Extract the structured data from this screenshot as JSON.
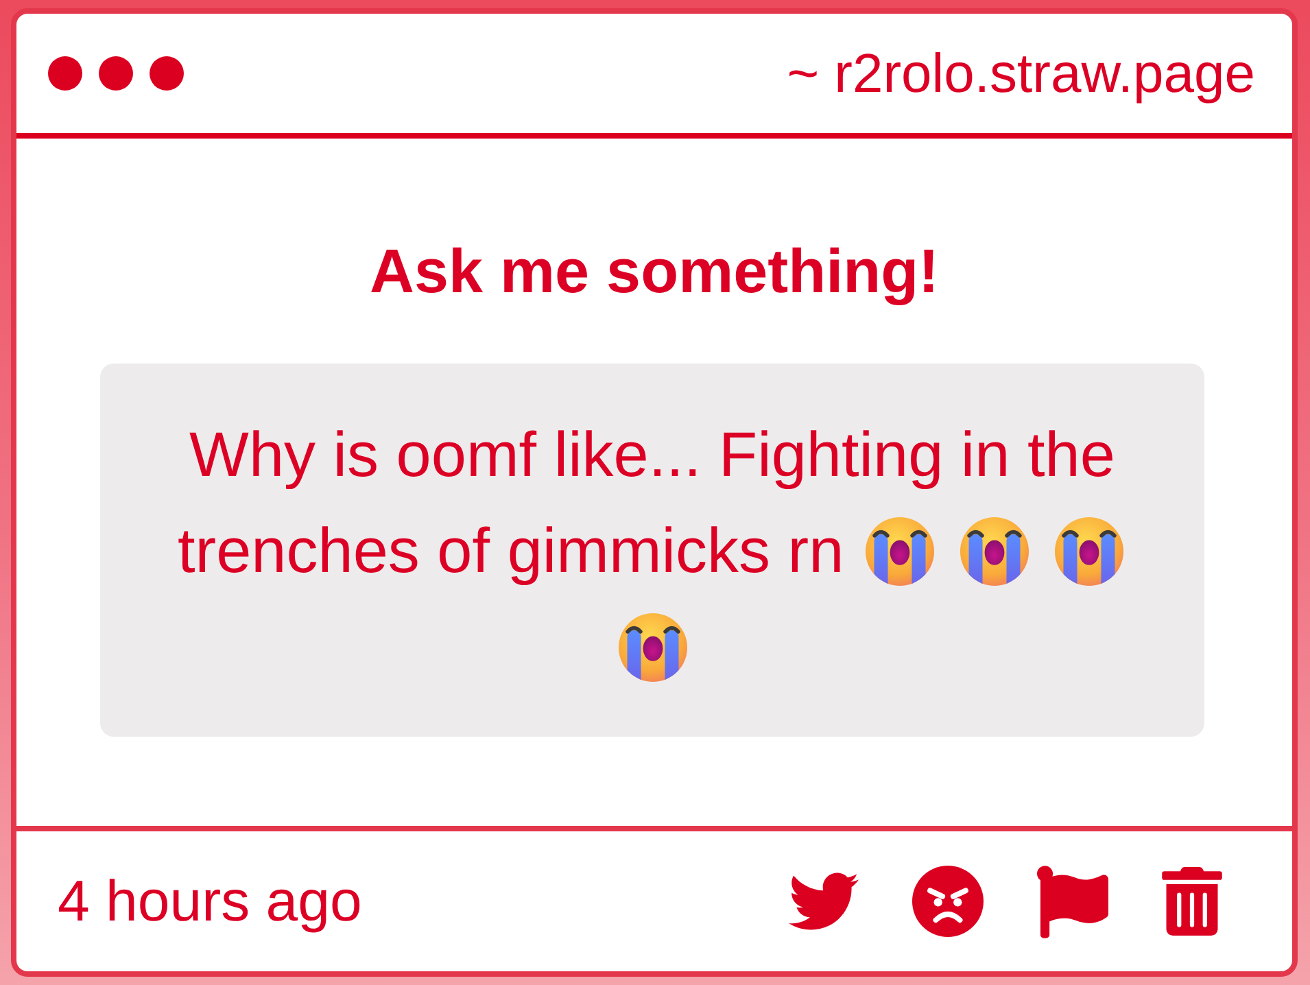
{
  "header": {
    "url": "~ r2rolo.straw.page"
  },
  "prompt": {
    "title": "Ask me something!"
  },
  "question": {
    "text": "Why is oomf like... Fighting in the trenches of gimmicks rn",
    "emojis": [
      {
        "kind": "crying"
      },
      {
        "kind": "crying"
      },
      {
        "kind": "crying"
      },
      {
        "kind": "crying"
      }
    ]
  },
  "footer": {
    "time": "4 hours ago",
    "actions": [
      {
        "kind": "bird"
      },
      {
        "kind": "angry"
      },
      {
        "kind": "flag"
      },
      {
        "kind": "trash"
      }
    ]
  }
}
